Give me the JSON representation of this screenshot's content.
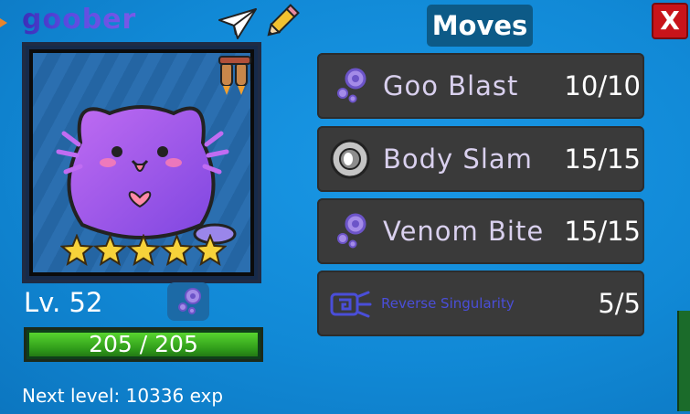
{
  "pet": {
    "name": "goober",
    "level_label": "Lv. 52",
    "hp_current": 205,
    "hp_max": 205,
    "hp_text": "205 / 205",
    "hp_fraction": 1.0,
    "stars": 5,
    "next_level_text": "Next level: 10336 exp",
    "type_icon": "goo-icon"
  },
  "moves_panel": {
    "title": "Moves",
    "close_label": "X",
    "moves": [
      {
        "name": "Goo Blast",
        "pp": "10/10",
        "icon": "goo-icon"
      },
      {
        "name": "Body Slam",
        "pp": "15/15",
        "icon": "body-slam-icon"
      },
      {
        "name": "Venom Bite",
        "pp": "15/15",
        "icon": "goo-icon"
      },
      {
        "name": "Reverse Singularity",
        "pp": "5/5",
        "icon": "singularity-icon"
      }
    ]
  },
  "colors": {
    "background": "#1189d6",
    "move_card": "#3a3a3a",
    "move_name": "#d9d0ee",
    "close_button": "#c8141a",
    "hp_fill": "#3fb522",
    "title_bg": "#0d5a87"
  }
}
